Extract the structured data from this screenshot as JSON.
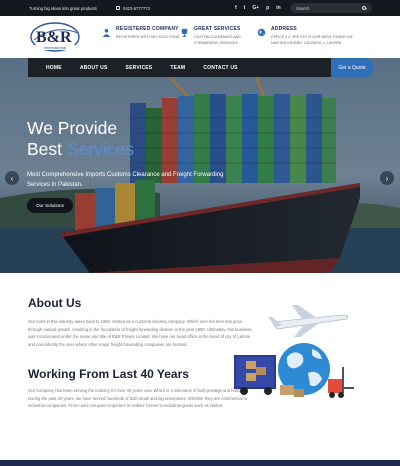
{
  "topbar": {
    "tagline": "Turning big ideas into great products",
    "phone": "0423-5777773",
    "socials": [
      "f",
      "t",
      "G+",
      "p",
      "in"
    ],
    "search_placeholder": "Search"
  },
  "logo": {
    "text": "B&R",
    "subtext": "International"
  },
  "info": [
    {
      "title": "REGISTERED COMPANY",
      "lines": [
        "REGISTERED WITH SEC ELECTIONS"
      ],
      "icon": "person-icon"
    },
    {
      "title": "GREAT SERVICES",
      "lines": [
        "CUSTOM CLEARANCE AND",
        "FORWARDING SERVICES"
      ],
      "icon": "trophy-icon"
    },
    {
      "title": "ADDRESS",
      "lines": [
        "OFFICE # 4, 3RD 4TH FLOOR NEDA TOWER 106",
        "NAVI BOULEVARD, GULBERG 1, LAHORE"
      ],
      "icon": "globe-icon"
    }
  ],
  "nav": {
    "items": [
      "HOME",
      "ABOUT US",
      "SERVICES",
      "TEAM",
      "CONTACT US"
    ],
    "quote": "Get a Quote"
  },
  "hero": {
    "line1": "We Provide",
    "line2_white": "Best ",
    "line2_accent": "Services",
    "subtitle": "Most Comprehensive Imports Customs Clearance and Freight Forwarding Services in Pakistan.",
    "button": "Our Solutions",
    "prev": "‹",
    "next": "›"
  },
  "about": {
    "title": "About Us",
    "text": "Our roots in this industry dates back to 1980, started as a customs clearing company. Which over the time has gone through natural growth, resulting in the foundation of freight forwarding division in the year 1998. Ultimately, this business was incorporated under the name and title of B&R Private Limited. We have our head office at the heart of city of Lahore and coincidently the area where other major freight forwarding companies are located.",
    "title2": "Working From Last 40 Years",
    "text2": "Our Company has been serving the industry for over 40 years now. Which is a milestone of both prestige and honor. During the past 40 years, we have served hundreds of both small and big enterprises. Whether they are commercial or industrial companies. From used computer importers in Hafeez Center to industrial giants such as Nishat."
  },
  "colors": {
    "accent": "#2f6fb8",
    "dark": "#15181f",
    "heading": "#1b2235"
  }
}
